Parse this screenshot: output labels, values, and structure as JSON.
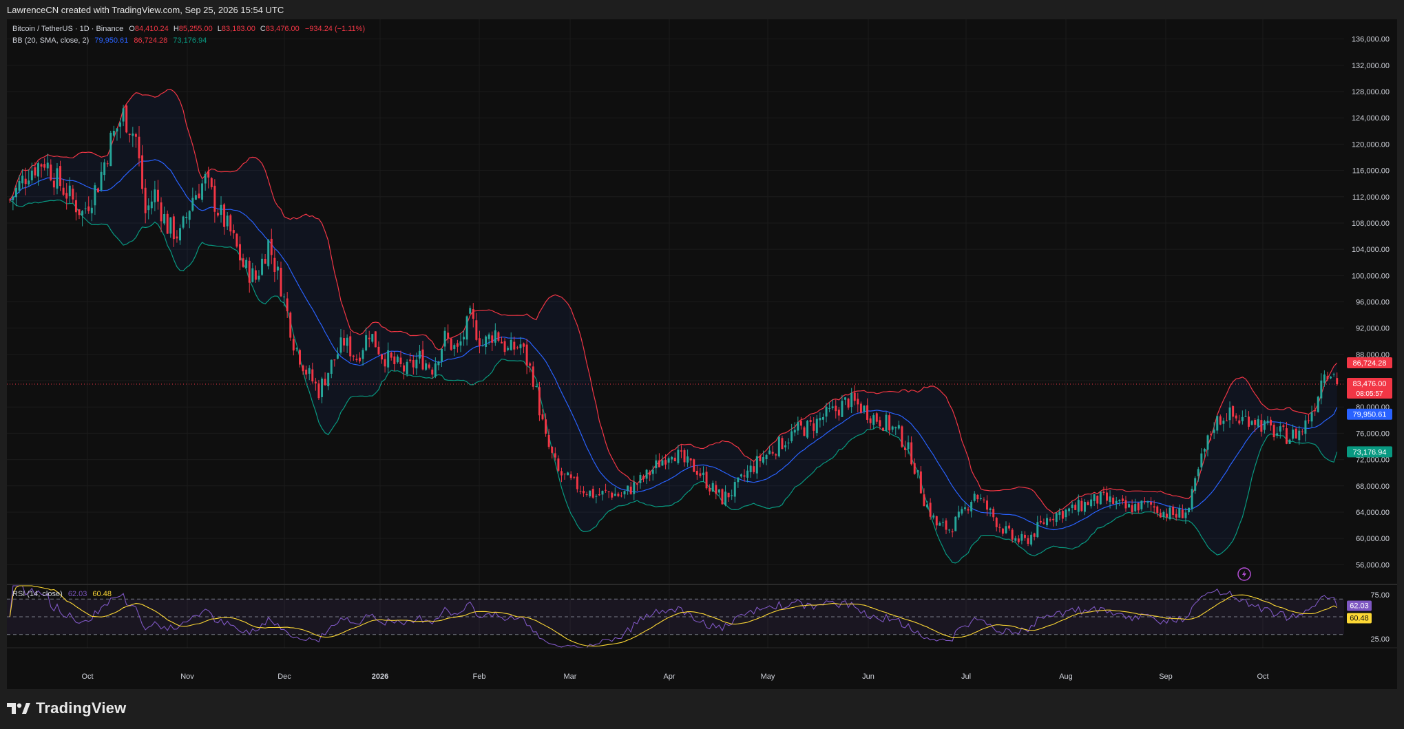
{
  "header": {
    "attribution": "LawrenceCN created with TradingView.com, Sep 25, 2026 15:54 UTC"
  },
  "footer": {
    "brand": "TradingView"
  },
  "legend": {
    "symbol": "Bitcoin / TetherUS · 1D · Binance",
    "open_label": "O",
    "open": "84,410.24",
    "high_label": "H",
    "high": "85,255.00",
    "low_label": "L",
    "low": "83,183.00",
    "close_label": "C",
    "close": "83,476.00",
    "change": "−934.24 (−1.11%)",
    "bb_label": "BB (20, SMA, close, 2)",
    "bb_basis": "79,950.61",
    "bb_upper": "86,724.28",
    "bb_lower": "73,176.94",
    "rsi_label": "RSI (14, close)",
    "rsi_value": "62.03",
    "rsi_ma": "60.48"
  },
  "price_badges": {
    "upper": "86,724.28",
    "last": "83,476.00",
    "countdown": "08:05:57",
    "basis": "79,950.61",
    "lower": "73,176.94"
  },
  "rsi_badges": {
    "rsi": "62.03",
    "ma": "60.48"
  },
  "colors": {
    "up": "#26a69a",
    "down": "#f23645",
    "bb_basis": "#2962ff",
    "bb_upper": "#f23645",
    "bb_lower": "#089981",
    "rsi": "#7e57c2",
    "rsi_ma": "#fdd835",
    "background": "#0f0f0f"
  },
  "chart_data": {
    "type": "candlestick",
    "symbol": "Bitcoin / TetherUS",
    "timeframe": "1D",
    "y_ticks": [
      "136,000.00",
      "132,000.00",
      "128,000.00",
      "124,000.00",
      "120,000.00",
      "116,000.00",
      "112,000.00",
      "108,000.00",
      "104,000.00",
      "100,000.00",
      "96,000.00",
      "92,000.00",
      "88,000.00",
      "84,000.00",
      "80,000.00",
      "76,000.00",
      "72,000.00",
      "68,000.00",
      "64,000.00",
      "60,000.00",
      "56,000.00"
    ],
    "y_tick_values": [
      136000,
      132000,
      128000,
      124000,
      120000,
      116000,
      112000,
      108000,
      104000,
      100000,
      96000,
      92000,
      88000,
      84000,
      80000,
      76000,
      72000,
      68000,
      64000,
      60000,
      56000
    ],
    "ylim": [
      53000,
      139000
    ],
    "x_ticks": [
      "Oct",
      "Nov",
      "Dec",
      "2026",
      "Feb",
      "Mar",
      "Apr",
      "May",
      "Jun",
      "Jul",
      "Aug",
      "Sep",
      "Oct"
    ],
    "close_path": [
      [
        0,
        111500
      ],
      [
        6,
        116000
      ],
      [
        11,
        117500
      ],
      [
        15,
        114500
      ],
      [
        19,
        112000
      ],
      [
        23,
        109500
      ],
      [
        28,
        114000
      ],
      [
        32,
        120500
      ],
      [
        36,
        124500
      ],
      [
        40,
        121000
      ],
      [
        43,
        109500
      ],
      [
        46,
        112500
      ],
      [
        50,
        107500
      ],
      [
        54,
        106000
      ],
      [
        58,
        112000
      ],
      [
        62,
        114500
      ],
      [
        66,
        110000
      ],
      [
        70,
        106500
      ],
      [
        74,
        101500
      ],
      [
        78,
        99500
      ],
      [
        82,
        105000
      ],
      [
        86,
        98500
      ],
      [
        90,
        90000
      ],
      [
        94,
        85500
      ],
      [
        98,
        82500
      ],
      [
        102,
        86500
      ],
      [
        106,
        90000
      ],
      [
        110,
        87500
      ],
      [
        114,
        91500
      ],
      [
        118,
        88000
      ],
      [
        122,
        86500
      ],
      [
        126,
        85500
      ],
      [
        130,
        87500
      ],
      [
        134,
        86000
      ],
      [
        138,
        90500
      ],
      [
        142,
        88500
      ],
      [
        146,
        93500
      ],
      [
        150,
        89500
      ],
      [
        154,
        91500
      ],
      [
        158,
        88500
      ],
      [
        162,
        89500
      ],
      [
        166,
        84500
      ],
      [
        170,
        75000
      ],
      [
        174,
        70000
      ],
      [
        178,
        68500
      ],
      [
        182,
        67500
      ],
      [
        186,
        66500
      ],
      [
        190,
        67000
      ],
      [
        194,
        66500
      ],
      [
        198,
        68000
      ],
      [
        202,
        69500
      ],
      [
        206,
        71500
      ],
      [
        210,
        73500
      ],
      [
        214,
        71500
      ],
      [
        218,
        70500
      ],
      [
        222,
        68000
      ],
      [
        226,
        66000
      ],
      [
        230,
        67500
      ],
      [
        234,
        70000
      ],
      [
        238,
        72000
      ],
      [
        242,
        73500
      ],
      [
        246,
        75000
      ],
      [
        250,
        76500
      ],
      [
        254,
        77000
      ],
      [
        258,
        78500
      ],
      [
        262,
        79500
      ],
      [
        266,
        81000
      ],
      [
        270,
        80000
      ],
      [
        274,
        78500
      ],
      [
        278,
        77500
      ],
      [
        282,
        76000
      ],
      [
        286,
        72500
      ],
      [
        290,
        66000
      ],
      [
        294,
        62000
      ],
      [
        298,
        61500
      ],
      [
        302,
        63500
      ],
      [
        306,
        67000
      ],
      [
        310,
        64500
      ],
      [
        314,
        62000
      ],
      [
        318,
        60000
      ],
      [
        322,
        59500
      ],
      [
        326,
        61500
      ],
      [
        330,
        63500
      ],
      [
        334,
        64000
      ],
      [
        338,
        64500
      ],
      [
        342,
        65500
      ],
      [
        346,
        66000
      ],
      [
        350,
        65500
      ],
      [
        354,
        64500
      ],
      [
        358,
        65000
      ],
      [
        362,
        65000
      ],
      [
        366,
        64000
      ],
      [
        370,
        63500
      ],
      [
        374,
        64500
      ],
      [
        378,
        72000
      ],
      [
        382,
        77500
      ],
      [
        386,
        79000
      ],
      [
        390,
        78000
      ],
      [
        394,
        78500
      ],
      [
        398,
        77000
      ],
      [
        402,
        76000
      ],
      [
        406,
        75500
      ],
      [
        410,
        76500
      ],
      [
        414,
        80500
      ],
      [
        417,
        86000
      ],
      [
        420,
        85000
      ],
      [
        421,
        83476
      ]
    ],
    "n_bars": 422,
    "last": {
      "open": 84410.24,
      "high": 85255.0,
      "low": 83183.0,
      "close": 83476.0,
      "change": -934.24,
      "change_pct": -1.11
    },
    "bollinger": {
      "period": 20,
      "mult": 2,
      "basis": 79950.61,
      "upper": 86724.28,
      "lower": 73176.94
    },
    "rsi": {
      "period": 14,
      "value": 62.03,
      "ma": 60.48,
      "levels": [
        70,
        50,
        30
      ],
      "y_ticks": [
        75,
        25
      ]
    },
    "grid": true
  }
}
